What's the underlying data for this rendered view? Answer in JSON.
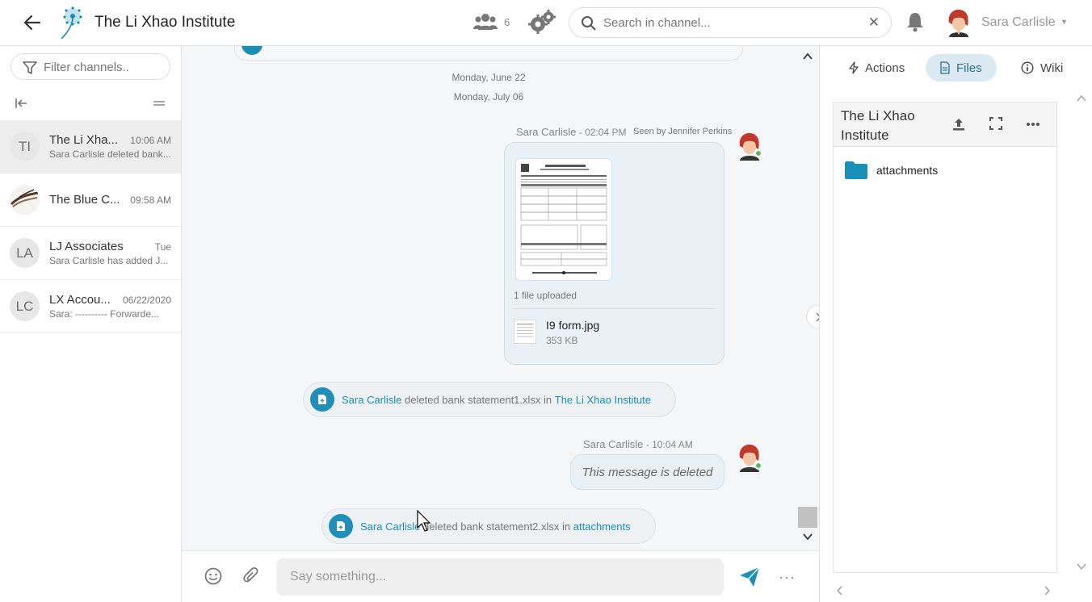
{
  "header": {
    "title": "The Li Xhao Institute",
    "member_count": "6",
    "search_placeholder": "Search in channel...",
    "user_name": "Sara Carlisle"
  },
  "sidebar": {
    "filter_placeholder": "Filter channels..",
    "channels": [
      {
        "initials": "TI",
        "name": "The Li Xha...",
        "time": "10:06 AM",
        "preview": "Sara Carlisle deleted bank...",
        "active": true
      },
      {
        "initials": "",
        "name": "The Blue C...",
        "time": "09:58 AM",
        "preview": "",
        "active": false
      },
      {
        "initials": "LA",
        "name": "LJ Associates",
        "time": "Tue",
        "preview": "Sara Carlisle has added J...",
        "active": false
      },
      {
        "initials": "LC",
        "name": "LX Accou...",
        "time": "06/22/2020",
        "preview": "Sara: ---------- Forwarde...",
        "active": false
      }
    ]
  },
  "chat": {
    "dates": [
      "Monday, June 22",
      "Monday, July 06"
    ],
    "messages": [
      {
        "sender": "Sara Carlisle",
        "time": " - 02:04 PM",
        "seen": "Seen by Jennifer Perkins",
        "upload_text": "1 file uploaded",
        "file_name": "I9 form.jpg",
        "file_size": "353 KB"
      },
      {
        "sender": "Sara Carlisle",
        "time": " - 10:04 AM",
        "text": "This message is deleted"
      }
    ],
    "system": [
      {
        "actor": "Sara Carlisle",
        "action": " deleted bank statement1.xlsx in ",
        "target": "The Li Xhao Institute"
      },
      {
        "actor": "Sara Carlisle",
        "action": " deleted bank statement2.xlsx in ",
        "target": "attachments"
      }
    ]
  },
  "composer": {
    "placeholder": "Say something...",
    "more": "···"
  },
  "right_panel": {
    "tabs": [
      {
        "label": "Actions",
        "icon": "lightning-icon"
      },
      {
        "label": "Files",
        "icon": "file-icon",
        "active": true
      },
      {
        "label": "Wiki",
        "icon": "info-icon"
      }
    ],
    "files_title": "The Li Xhao Institute",
    "folders": [
      "attachments"
    ]
  },
  "colors": {
    "accent": "#1a8fb8",
    "bubble": "#e9f1f6",
    "chat_bg": "#f4f6f7",
    "tab_active": "#dbe9f3"
  }
}
